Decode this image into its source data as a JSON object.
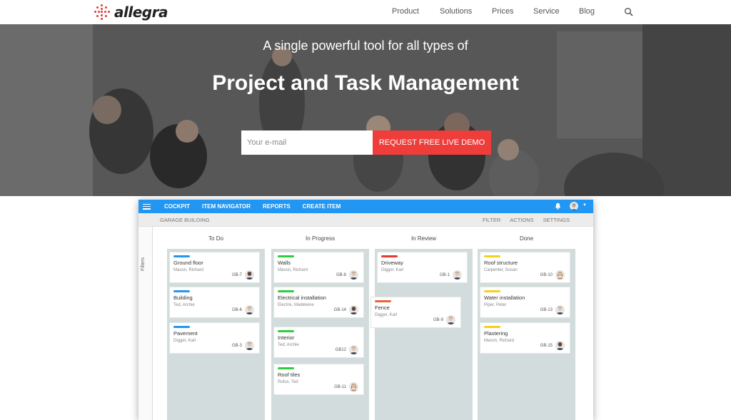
{
  "brand": {
    "name": "allegra",
    "accent": "#e53935"
  },
  "nav": {
    "links": [
      "Product",
      "Solutions",
      "Prices",
      "Service",
      "Blog"
    ],
    "search_icon": "search-icon"
  },
  "hero": {
    "subtitle": "A single powerful tool for all types of",
    "title": "Project and Task Management",
    "email_placeholder": "Your e-mail",
    "cta_label": "REQUEST FREE LIVE DEMO",
    "cta_color": "#ee3d3a"
  },
  "app": {
    "menu": [
      "COCKPIT",
      "ITEM NAVIGATOR",
      "REPORTS",
      "CREATE ITEM"
    ],
    "bar_color": "#2196f3",
    "breadcrumb": "GARAGE BUILDING",
    "actions": [
      "FILTER",
      "ACTIONS",
      "SETTINGS"
    ],
    "filters_label": "Filters",
    "columns": [
      {
        "name": "To Do",
        "cards": [
          {
            "title": "Ground floor",
            "people": "Mason, Richard",
            "id": "GB-7",
            "tag": "#2196f3",
            "avatar": "dark"
          },
          {
            "title": "Building",
            "people": "Ted, Archie",
            "id": "GB-6",
            "tag": "#2196f3",
            "avatar": "light"
          },
          {
            "title": "Pavement",
            "people": "Digger, Karl",
            "id": "GB-3",
            "tag": "#2196f3",
            "avatar": "light"
          }
        ]
      },
      {
        "name": "In Progress",
        "cards": [
          {
            "title": "Walls",
            "people": "Mason, Richard",
            "id": "GB-8",
            "tag": "#2ecc40",
            "avatar": "light"
          },
          {
            "title": "Electrical installation",
            "people": "Electrix, Madeleine",
            "id": "GB-14",
            "tag": "#2ecc40",
            "avatar": "dark"
          },
          {
            "title": "Interior",
            "people": "Ted, Archie",
            "id": "GB12",
            "tag": "#2ecc40",
            "avatar": "light"
          },
          {
            "title": "Roof tiles",
            "people": "Rufus, Ted",
            "id": "GB-11",
            "tag": "#2ecc40",
            "avatar": "woman"
          }
        ]
      },
      {
        "name": "In Review",
        "cards": [
          {
            "title": "Driveway",
            "people": "Digger, Karl",
            "id": "GB-1",
            "tag": "#e53935",
            "avatar": "light"
          },
          {
            "title": "Fence",
            "people": "Digger, Karl",
            "id": "GB-9",
            "tag": "#e8643a",
            "avatar": "light"
          }
        ]
      },
      {
        "name": "Done",
        "cards": [
          {
            "title": "Roof structure",
            "people": "Carpenter, Susan",
            "id": "GB-10",
            "tag": "#f5d020",
            "avatar": "woman"
          },
          {
            "title": "Water installation",
            "people": "Piper, Peter",
            "id": "GB-13",
            "tag": "#f5d020",
            "avatar": "light"
          },
          {
            "title": "Plastering",
            "people": "Mason, Richard",
            "id": "GB-15",
            "tag": "#f5d020",
            "avatar": "dark"
          }
        ]
      }
    ]
  }
}
